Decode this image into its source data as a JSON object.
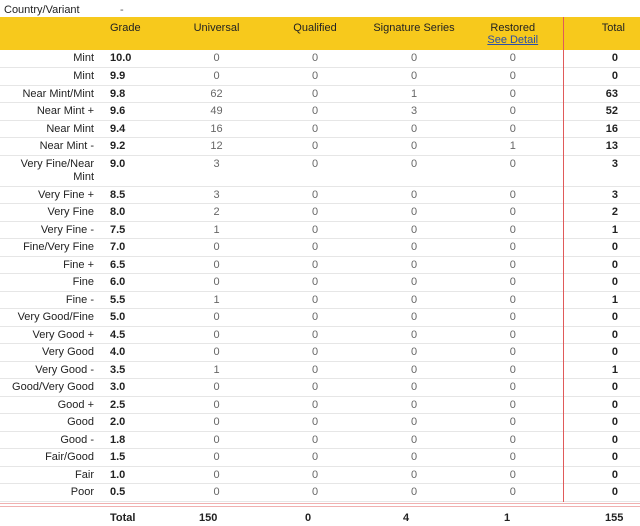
{
  "header": {
    "country_label": "Country/Variant",
    "country_value": "-"
  },
  "columns": {
    "grade": "Grade",
    "universal": "Universal",
    "qualified": "Qualified",
    "signature": "Signature Series",
    "restored": "Restored",
    "restored_link": "See Detail",
    "total": "Total"
  },
  "rows": [
    {
      "name": "Mint",
      "grade": "10.0",
      "universal": "0",
      "qualified": "0",
      "signature": "0",
      "restored": "0",
      "total": "0"
    },
    {
      "name": "Mint",
      "grade": "9.9",
      "universal": "0",
      "qualified": "0",
      "signature": "0",
      "restored": "0",
      "total": "0"
    },
    {
      "name": "Near Mint/Mint",
      "grade": "9.8",
      "universal": "62",
      "qualified": "0",
      "signature": "1",
      "restored": "0",
      "total": "63"
    },
    {
      "name": "Near Mint +",
      "grade": "9.6",
      "universal": "49",
      "qualified": "0",
      "signature": "3",
      "restored": "0",
      "total": "52"
    },
    {
      "name": "Near Mint",
      "grade": "9.4",
      "universal": "16",
      "qualified": "0",
      "signature": "0",
      "restored": "0",
      "total": "16"
    },
    {
      "name": "Near Mint -",
      "grade": "9.2",
      "universal": "12",
      "qualified": "0",
      "signature": "0",
      "restored": "1",
      "total": "13"
    },
    {
      "name": "Very Fine/Near Mint",
      "grade": "9.0",
      "universal": "3",
      "qualified": "0",
      "signature": "0",
      "restored": "0",
      "total": "3",
      "two": true
    },
    {
      "name": "Very Fine +",
      "grade": "8.5",
      "universal": "3",
      "qualified": "0",
      "signature": "0",
      "restored": "0",
      "total": "3"
    },
    {
      "name": "Very Fine",
      "grade": "8.0",
      "universal": "2",
      "qualified": "0",
      "signature": "0",
      "restored": "0",
      "total": "2"
    },
    {
      "name": "Very Fine -",
      "grade": "7.5",
      "universal": "1",
      "qualified": "0",
      "signature": "0",
      "restored": "0",
      "total": "1"
    },
    {
      "name": "Fine/Very Fine",
      "grade": "7.0",
      "universal": "0",
      "qualified": "0",
      "signature": "0",
      "restored": "0",
      "total": "0"
    },
    {
      "name": "Fine +",
      "grade": "6.5",
      "universal": "0",
      "qualified": "0",
      "signature": "0",
      "restored": "0",
      "total": "0"
    },
    {
      "name": "Fine",
      "grade": "6.0",
      "universal": "0",
      "qualified": "0",
      "signature": "0",
      "restored": "0",
      "total": "0"
    },
    {
      "name": "Fine -",
      "grade": "5.5",
      "universal": "1",
      "qualified": "0",
      "signature": "0",
      "restored": "0",
      "total": "1"
    },
    {
      "name": "Very Good/Fine",
      "grade": "5.0",
      "universal": "0",
      "qualified": "0",
      "signature": "0",
      "restored": "0",
      "total": "0"
    },
    {
      "name": "Very Good +",
      "grade": "4.5",
      "universal": "0",
      "qualified": "0",
      "signature": "0",
      "restored": "0",
      "total": "0"
    },
    {
      "name": "Very Good",
      "grade": "4.0",
      "universal": "0",
      "qualified": "0",
      "signature": "0",
      "restored": "0",
      "total": "0"
    },
    {
      "name": "Very Good -",
      "grade": "3.5",
      "universal": "1",
      "qualified": "0",
      "signature": "0",
      "restored": "0",
      "total": "1"
    },
    {
      "name": "Good/Very Good",
      "grade": "3.0",
      "universal": "0",
      "qualified": "0",
      "signature": "0",
      "restored": "0",
      "total": "0"
    },
    {
      "name": "Good +",
      "grade": "2.5",
      "universal": "0",
      "qualified": "0",
      "signature": "0",
      "restored": "0",
      "total": "0"
    },
    {
      "name": "Good",
      "grade": "2.0",
      "universal": "0",
      "qualified": "0",
      "signature": "0",
      "restored": "0",
      "total": "0"
    },
    {
      "name": "Good -",
      "grade": "1.8",
      "universal": "0",
      "qualified": "0",
      "signature": "0",
      "restored": "0",
      "total": "0"
    },
    {
      "name": "Fair/Good",
      "grade": "1.5",
      "universal": "0",
      "qualified": "0",
      "signature": "0",
      "restored": "0",
      "total": "0"
    },
    {
      "name": "Fair",
      "grade": "1.0",
      "universal": "0",
      "qualified": "0",
      "signature": "0",
      "restored": "0",
      "total": "0"
    },
    {
      "name": "Poor",
      "grade": "0.5",
      "universal": "0",
      "qualified": "0",
      "signature": "0",
      "restored": "0",
      "total": "0"
    }
  ],
  "footer": {
    "label": "Total",
    "universal": "150",
    "qualified": "0",
    "signature": "4",
    "restored": "1",
    "total": "155"
  }
}
